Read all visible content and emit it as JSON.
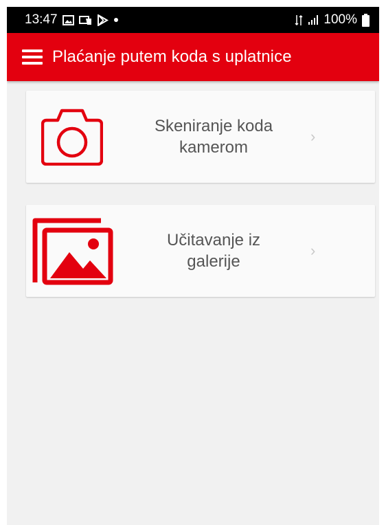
{
  "status_bar": {
    "time": "13:47",
    "battery": "100%",
    "icons": [
      "image-notification-icon",
      "message-notification-icon",
      "play-store-icon",
      "notification-dot-icon",
      "data-arrows-icon",
      "signal-icon",
      "battery-icon"
    ]
  },
  "app_bar": {
    "title": "Plaćanje putem koda s uplatnice",
    "menu_icon": "hamburger-menu-icon"
  },
  "options": {
    "scan": {
      "label_line1": "Skeniranje koda",
      "label_line2": "kamerom",
      "icon": "camera-icon"
    },
    "gallery": {
      "label_line1": "Učitavanje iz",
      "label_line2": "galerije",
      "icon": "gallery-icon"
    }
  },
  "colors": {
    "brand_red": "#e3000f",
    "status_bar": "#000000",
    "background": "#f1f1f1",
    "card": "#fafafa",
    "label_text": "#555555",
    "chevron": "#c8c8c8"
  }
}
